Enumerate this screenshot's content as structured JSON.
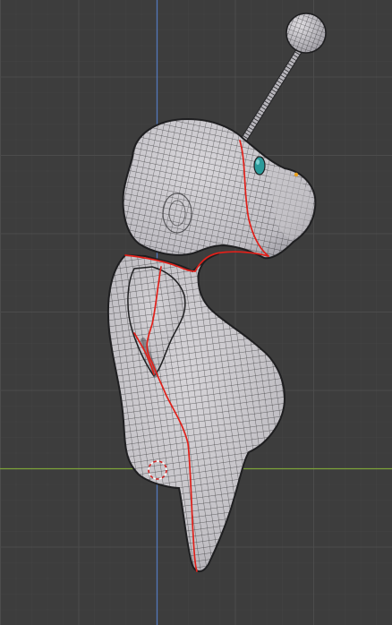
{
  "viewport": {
    "background_color": "#3d3d3d",
    "grid_major_color": "#4c4c4c",
    "grid_minor_color": "#444444",
    "axis_z_color": "#5377b8",
    "axis_y_color": "#7ea33a",
    "mesh_surface_color": "#c4c2c6",
    "wireframe_color": "#2a2a2c",
    "seam_color": "#e0201a",
    "eye_color": "#2a9a9a",
    "antenna_tip_color": "#c8c6cc",
    "vertex_highlight_color": "#e8a020",
    "cursor_3d_colors": [
      "#d02020",
      "#ffffff"
    ]
  }
}
